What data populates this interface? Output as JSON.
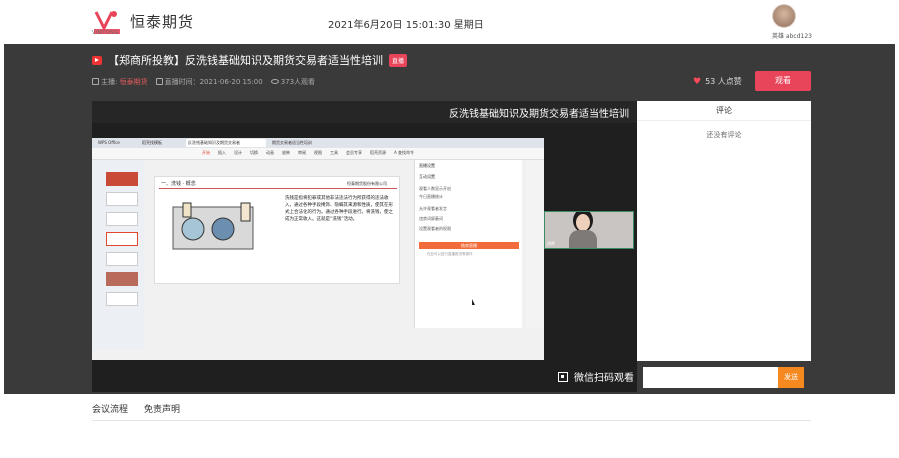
{
  "header": {
    "logo_sub": "VIMTONG",
    "brand": "恒泰期货",
    "datetime": "2021年6月20日 15:01:30 星期日",
    "user_name": "英雄 abcd123"
  },
  "live": {
    "title": "【郑商所投教】反洗钱基础知识及期货交易者适当性培训",
    "badge": "直播",
    "host_label": "主播:",
    "host_name": "恒泰期货",
    "time_label": "直播时间：2021-06-20 15:00",
    "views": "373人观看",
    "likes": "53 人点赞",
    "watch_button": "观看",
    "qr_text": "微信扫码观看"
  },
  "video": {
    "banner_title": "反洗钱基础知识及期货交易者适当性培训",
    "browser_tabs": [
      "WPS Office",
      "稻壳找模板",
      "反洗钱基础知识及期货交易者",
      "期货交易者适当性培训"
    ],
    "ribbon_items": [
      "开始",
      "插入",
      "设计",
      "切换",
      "动画",
      "放映",
      "审阅",
      "视图",
      "工具",
      "会员专享",
      "稻壳资源",
      "A 查找命令"
    ],
    "slide": {
      "header": "一、洗钱 · 概念",
      "company": "恒泰期货股份有限公司",
      "body": "洗钱是指将犯罪或其他非法违法行为所获得的违法收入，通过各种手段掩饰、隐瞒其来源和性质，使其在形式上合法化的行为。通过各种手段进行。将洗钱，使之成为正常收入。这就是“洗钱”活动。"
    },
    "side_panel": {
      "title": "直播设置",
      "section_label": "互动设置",
      "line1": "观看人数显示开启",
      "line2": "今日直播统计",
      "line3": "允许观看者发言",
      "line4": "违禁词屏蔽词",
      "line5": "设置观看者的权限",
      "button": "结束直播",
      "foot": "在此可以进行直播推流等操作"
    },
    "webcam_label": "讲师"
  },
  "comments": {
    "header": "评论",
    "empty": "还没有评论",
    "input_placeholder": "",
    "send_button": "发送"
  },
  "tabs": [
    "会议流程",
    "免责声明"
  ]
}
